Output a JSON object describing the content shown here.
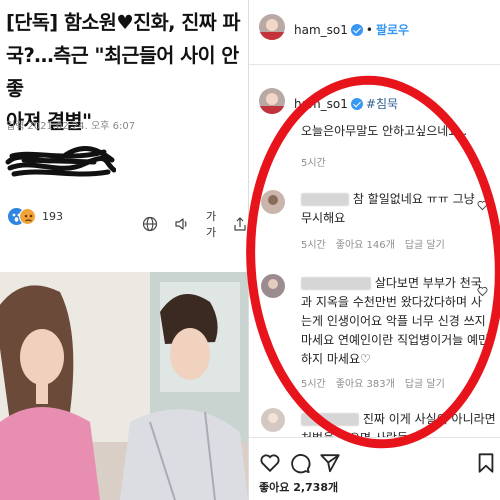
{
  "article": {
    "headline_line1": "[단독] 함소원♥진화, 진짜 파",
    "headline_line2": "국?…측근 \"최근들어 사이 안좋",
    "headline_line3": "아져 결별\"",
    "date_label": "입력",
    "date_value": "2021.02.24. 오후 6:07",
    "reaction_count": "193",
    "font_size_tool": "가가"
  },
  "instagram": {
    "username": "ham_so1",
    "separator": "•",
    "follow_label": "팔로우",
    "caption_username": "ham_so1",
    "caption_hashtag": "#침묵",
    "caption_text": "오늘은아무말도 안하고싶으네요..",
    "caption_time": "5시간",
    "comments": [
      {
        "text": "참 할일없네요 ㅠㅠ 그냥 무시해요",
        "time": "5시간",
        "likes": "좋아요 146개",
        "reply": "답글 달기"
      },
      {
        "text": "살다보면 부부가 천국과 지옥을 수천만번 왔다갔다하며 사는게 인생이어요 악플 너무 신경 쓰지 마세요 연예인이란 직업병이거늘 예민하지 마세요♡",
        "time": "5시간",
        "likes": "좋아요 383개",
        "reply": "답글 달기"
      },
      {
        "text": "진짜 이게 사실이 아니라면 처벌을 받으면 사람들..."
      }
    ],
    "likes_total": "좋아요 2,738개"
  },
  "colors": {
    "accent_blue": "#3897f0",
    "annotation_red": "#e8141b",
    "hashtag": "#2b5d8f"
  }
}
